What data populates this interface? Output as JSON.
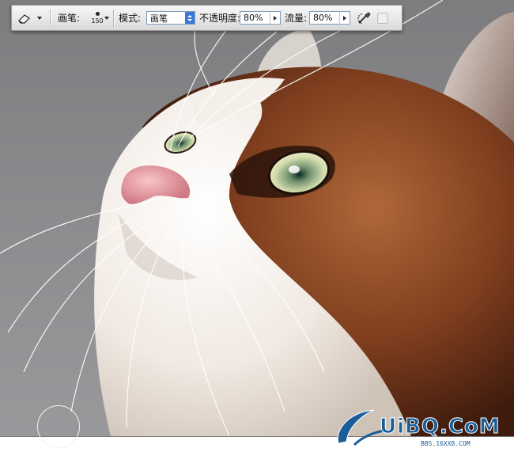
{
  "toolbar": {
    "tool_icon": "eraser-icon",
    "brush_label": "画笔:",
    "brush_size": "150",
    "mode_label": "模式:",
    "mode_value": "画笔",
    "opacity_label": "不透明度:",
    "opacity_value": "80%",
    "flow_label": "流量:",
    "flow_value": "80%",
    "airbrush_icon": "airbrush-icon"
  },
  "canvas": {
    "background_color": "#8c8c8e",
    "subject": "cat-portrait"
  },
  "watermark": {
    "main_text": "UiBQ.CoM",
    "sub_text": "BBS.16XX8.COM",
    "color": "#1a5d99"
  },
  "colors": {
    "fur_brown": "#8a4420",
    "fur_white": "#f4ede6",
    "eye_green": "#c9d7a6",
    "nose_pink": "#f0a9ae"
  }
}
